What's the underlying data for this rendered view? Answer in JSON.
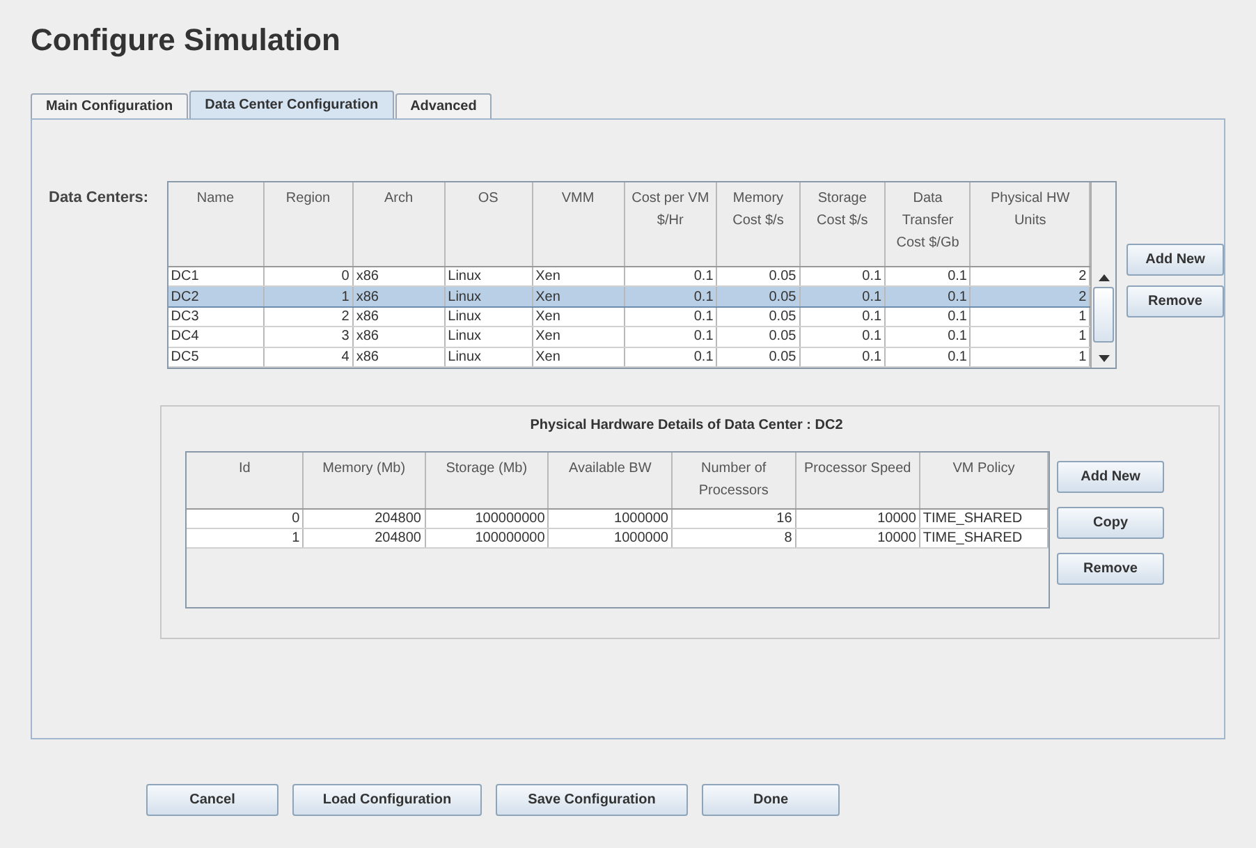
{
  "title": "Configure Simulation",
  "tabs": [
    {
      "label": "Main Configuration",
      "selected": false
    },
    {
      "label": "Data Center Configuration",
      "selected": true
    },
    {
      "label": "Advanced",
      "selected": false
    }
  ],
  "data_centers": {
    "label": "Data Centers:",
    "columns": [
      {
        "label": "Name",
        "kind": "text"
      },
      {
        "label": "Region",
        "kind": "number"
      },
      {
        "label": "Arch",
        "kind": "text"
      },
      {
        "label": "OS",
        "kind": "text"
      },
      {
        "label": "VMM",
        "kind": "text"
      },
      {
        "label": "Cost per VM $/Hr",
        "kind": "number"
      },
      {
        "label": "Memory Cost $/s",
        "kind": "number"
      },
      {
        "label": "Storage Cost $/s",
        "kind": "number"
      },
      {
        "label": "Data Transfer Cost $/Gb",
        "kind": "number"
      },
      {
        "label": "Physical HW Units",
        "kind": "number"
      }
    ],
    "rows": [
      {
        "selected": false,
        "cells": [
          "DC1",
          "0",
          "x86",
          "Linux",
          "Xen",
          "0.1",
          "0.05",
          "0.1",
          "0.1",
          "2"
        ]
      },
      {
        "selected": true,
        "cells": [
          "DC2",
          "1",
          "x86",
          "Linux",
          "Xen",
          "0.1",
          "0.05",
          "0.1",
          "0.1",
          "2"
        ]
      },
      {
        "selected": false,
        "cells": [
          "DC3",
          "2",
          "x86",
          "Linux",
          "Xen",
          "0.1",
          "0.05",
          "0.1",
          "0.1",
          "1"
        ]
      },
      {
        "selected": false,
        "cells": [
          "DC4",
          "3",
          "x86",
          "Linux",
          "Xen",
          "0.1",
          "0.05",
          "0.1",
          "0.1",
          "1"
        ]
      },
      {
        "selected": false,
        "cells": [
          "DC5",
          "4",
          "x86",
          "Linux",
          "Xen",
          "0.1",
          "0.05",
          "0.1",
          "0.1",
          "1"
        ]
      }
    ],
    "buttons": [
      "Add New",
      "Remove"
    ]
  },
  "hardware": {
    "title": "Physical Hardware Details of Data Center : DC2",
    "columns": [
      {
        "label": "Id",
        "kind": "number"
      },
      {
        "label": "Memory (Mb)",
        "kind": "number"
      },
      {
        "label": "Storage (Mb)",
        "kind": "number"
      },
      {
        "label": "Available BW",
        "kind": "number"
      },
      {
        "label": "Number of Processors",
        "kind": "number"
      },
      {
        "label": "Processor Speed",
        "kind": "number"
      },
      {
        "label": "VM Policy",
        "kind": "text"
      }
    ],
    "rows": [
      {
        "cells": [
          "0",
          "204800",
          "100000000",
          "1000000",
          "16",
          "10000",
          "TIME_SHARED"
        ]
      },
      {
        "cells": [
          "1",
          "204800",
          "100000000",
          "1000000",
          "8",
          "10000",
          "TIME_SHARED"
        ]
      }
    ],
    "buttons": [
      "Add New",
      "Copy",
      "Remove"
    ]
  },
  "footer_buttons": [
    "Cancel",
    "Load Configuration",
    "Save Configuration",
    "Done"
  ]
}
